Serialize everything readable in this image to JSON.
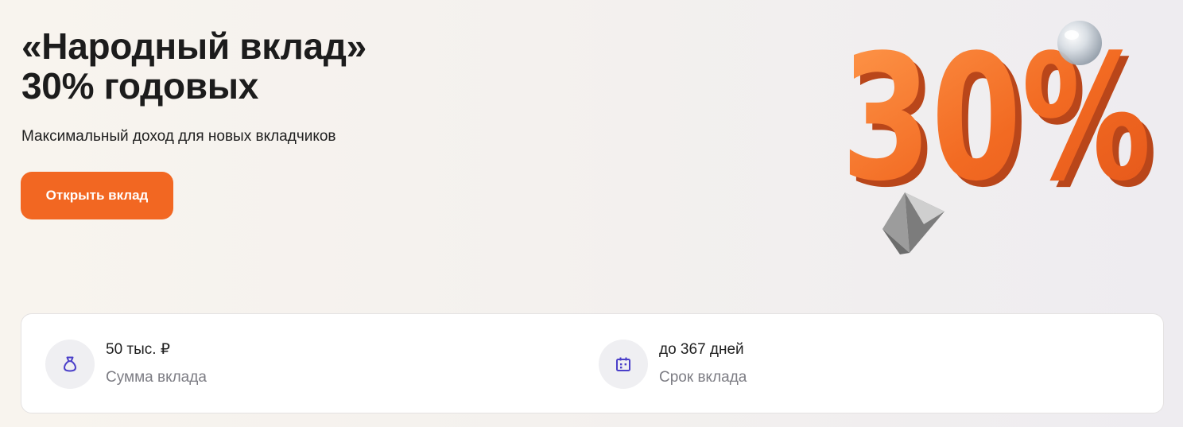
{
  "hero": {
    "title_line1": "«Народный вклад»",
    "title_line2": "30% годовых",
    "subtitle": "Максимальный доход для новых вкладчиков",
    "cta_label": "Открыть вклад"
  },
  "promo_graphic": {
    "text": "30%",
    "accent_color": "#f26722"
  },
  "deposit_info": {
    "amount": {
      "value": "50 тыс. ₽",
      "label": "Сумма вклада",
      "icon": "money-bag-icon"
    },
    "term": {
      "value": "до 367 дней",
      "label": "Срок вклада",
      "icon": "calendar-icon"
    }
  },
  "colors": {
    "accent": "#f26722",
    "icon": "#4a3fc9",
    "muted_text": "#7d7d84",
    "card_background": "#ffffff"
  }
}
